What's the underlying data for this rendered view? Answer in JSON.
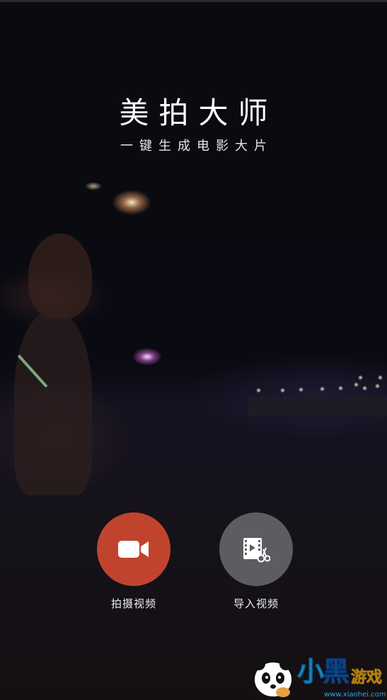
{
  "app": {
    "title": "美拍大师",
    "subtitle": "一键生成电影大片"
  },
  "actions": {
    "shoot": {
      "label": "拍摄视频",
      "icon": "video-camera-icon",
      "color": "#c0442d"
    },
    "import": {
      "label": "导入视频",
      "icon": "film-scissors-icon",
      "color": "#5d5c61"
    }
  },
  "watermark": {
    "logo": "小黑游戏",
    "url": "www.xiaohei.com"
  }
}
